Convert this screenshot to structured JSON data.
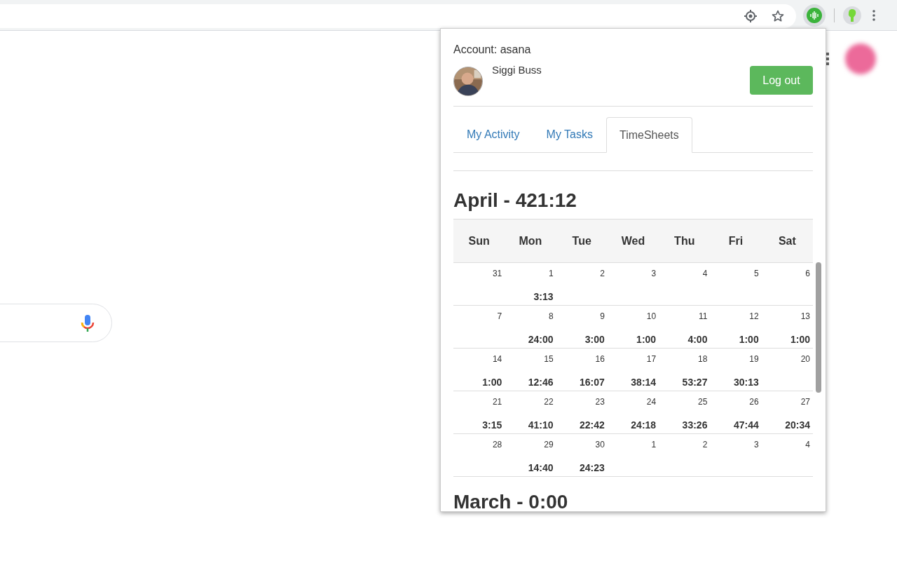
{
  "account": {
    "label": "Account: asana",
    "user_name": "Siggi Buss",
    "logout_button": "Log out"
  },
  "tabs": [
    {
      "label": "My Activity",
      "selected": false
    },
    {
      "label": "My Tasks",
      "selected": false
    },
    {
      "label": "TimeSheets",
      "selected": true
    }
  ],
  "months": [
    {
      "title": "April - 421:12",
      "weekdays": [
        "Sun",
        "Mon",
        "Tue",
        "Wed",
        "Thu",
        "Fri",
        "Sat"
      ],
      "weeks": [
        [
          {
            "date": "31"
          },
          {
            "date": "1",
            "time": "3:13"
          },
          {
            "date": "2"
          },
          {
            "date": "3"
          },
          {
            "date": "4"
          },
          {
            "date": "5"
          },
          {
            "date": "6"
          }
        ],
        [
          {
            "date": "7"
          },
          {
            "date": "8",
            "time": "24:00"
          },
          {
            "date": "9",
            "time": "3:00"
          },
          {
            "date": "10",
            "time": "1:00"
          },
          {
            "date": "11",
            "time": "4:00"
          },
          {
            "date": "12",
            "time": "1:00"
          },
          {
            "date": "13",
            "time": "1:00"
          }
        ],
        [
          {
            "date": "14",
            "time": "1:00"
          },
          {
            "date": "15",
            "time": "12:46"
          },
          {
            "date": "16",
            "time": "16:07"
          },
          {
            "date": "17",
            "time": "38:14"
          },
          {
            "date": "18",
            "time": "53:27"
          },
          {
            "date": "19",
            "time": "30:13"
          },
          {
            "date": "20"
          }
        ],
        [
          {
            "date": "21",
            "time": "3:15"
          },
          {
            "date": "22",
            "time": "41:10"
          },
          {
            "date": "23",
            "time": "22:42"
          },
          {
            "date": "24",
            "time": "24:18"
          },
          {
            "date": "25",
            "time": "33:26"
          },
          {
            "date": "26",
            "time": "47:44"
          },
          {
            "date": "27",
            "time": "20:34"
          }
        ],
        [
          {
            "date": "28"
          },
          {
            "date": "29",
            "time": "14:40"
          },
          {
            "date": "30",
            "time": "24:23"
          },
          {
            "date": "1"
          },
          {
            "date": "2"
          },
          {
            "date": "3"
          },
          {
            "date": "4"
          }
        ]
      ]
    },
    {
      "title": "March - 0:00"
    }
  ]
}
